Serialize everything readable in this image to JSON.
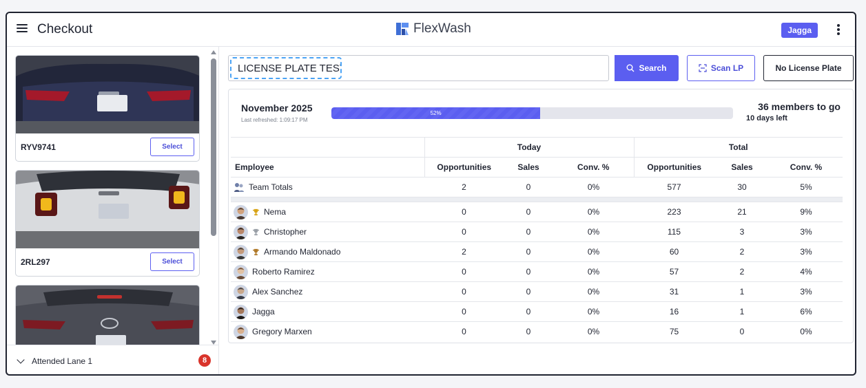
{
  "header": {
    "title": "Checkout",
    "brand": "FlexWash",
    "user": "Jagga"
  },
  "sidebar": {
    "cars": [
      {
        "plate": "RYV9741",
        "select_label": "Select"
      },
      {
        "plate": "2RL297",
        "select_label": "Select"
      },
      {
        "plate": "",
        "select_label": ""
      }
    ],
    "lane": {
      "label": "Attended Lane 1",
      "count": "8"
    }
  },
  "search": {
    "value": "LICENSE PLATE TEST",
    "button": "Search"
  },
  "actions": {
    "scan": "Scan LP",
    "no_plate": "No License Plate"
  },
  "goal": {
    "month": "November 2025",
    "refreshed": "Last refreshed: 1:09:17 PM",
    "progress_label": "52%",
    "progress_fraction": 0.52,
    "remaining": "36 members to go",
    "days_left": "10 days left"
  },
  "table": {
    "group_today": "Today",
    "group_total": "Total",
    "columns": [
      "Employee",
      "Opportunities",
      "Sales",
      "Conv. %",
      "Opportunities",
      "Sales",
      "Conv. %"
    ],
    "team": {
      "name": "Team Totals",
      "today_opps": "2",
      "today_sales": "0",
      "today_conv": "0%",
      "total_opps": "577",
      "total_sales": "30",
      "total_conv": "5%"
    },
    "rows": [
      {
        "name": "Nema",
        "trophy": "gold",
        "today_opps": "0",
        "today_sales": "0",
        "today_conv": "0%",
        "total_opps": "223",
        "total_sales": "21",
        "total_conv": "9%"
      },
      {
        "name": "Christopher",
        "trophy": "silver",
        "today_opps": "0",
        "today_sales": "0",
        "today_conv": "0%",
        "total_opps": "115",
        "total_sales": "3",
        "total_conv": "3%"
      },
      {
        "name": "Armando Maldonado",
        "trophy": "bronze",
        "today_opps": "2",
        "today_sales": "0",
        "today_conv": "0%",
        "total_opps": "60",
        "total_sales": "2",
        "total_conv": "3%"
      },
      {
        "name": "Roberto Ramirez",
        "trophy": "",
        "today_opps": "0",
        "today_sales": "0",
        "today_conv": "0%",
        "total_opps": "57",
        "total_sales": "2",
        "total_conv": "4%"
      },
      {
        "name": "Alex Sanchez",
        "trophy": "",
        "today_opps": "0",
        "today_sales": "0",
        "today_conv": "0%",
        "total_opps": "31",
        "total_sales": "1",
        "total_conv": "3%"
      },
      {
        "name": "Jagga",
        "trophy": "",
        "today_opps": "0",
        "today_sales": "0",
        "today_conv": "0%",
        "total_opps": "16",
        "total_sales": "1",
        "total_conv": "6%"
      },
      {
        "name": "Gregory Marxen",
        "trophy": "",
        "today_opps": "0",
        "today_sales": "0",
        "today_conv": "0%",
        "total_opps": "75",
        "total_sales": "0",
        "total_conv": "0%"
      }
    ]
  },
  "colors": {
    "accent": "#5b5ef0",
    "arrow": "#1a9be8",
    "badge_red": "#d9342b"
  }
}
